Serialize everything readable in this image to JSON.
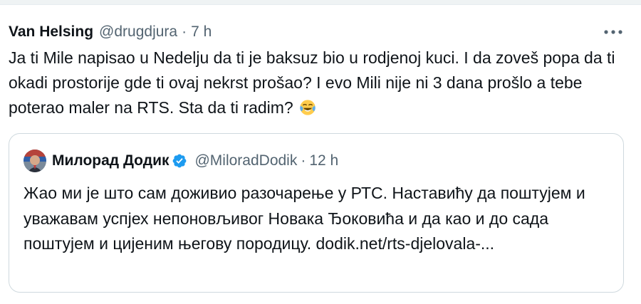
{
  "tweet": {
    "author_name": "Van Helsing",
    "author_handle": "@drugdjura",
    "separator": "·",
    "time": "7 h",
    "more_icon": "more-horizontal-icon",
    "text": "Ja ti Mile napisao u Nedelju da ti je baksuz  bio u rodjenoj kuci. I da zoveš popa da ti okadi prostorije gde ti ovaj nekrst prošao? I evo Mili nije ni 3 dana prošlo a tebe poterao maler na RTS. Sta da ti radim?",
    "emoji": "face-with-tears-of-joy-icon"
  },
  "quote": {
    "author_name": "Милорад Додик",
    "verified_icon": "verified-badge-icon",
    "author_handle": "@MiloradDodik",
    "separator": "·",
    "time": "12 h",
    "text": "Жао ми је што сам доживио разочарење у РТС. Наставићу да поштујем и уважавам успјех непоновљивог Новака Ђоковића и да као и до сада поштујем и цијеним његову породицу. dodik.net/rts-djelovala-..."
  },
  "colors": {
    "text_primary": "#0f1419",
    "text_secondary": "#536471",
    "border": "#cfd9de",
    "verified": "#1d9bf0"
  }
}
